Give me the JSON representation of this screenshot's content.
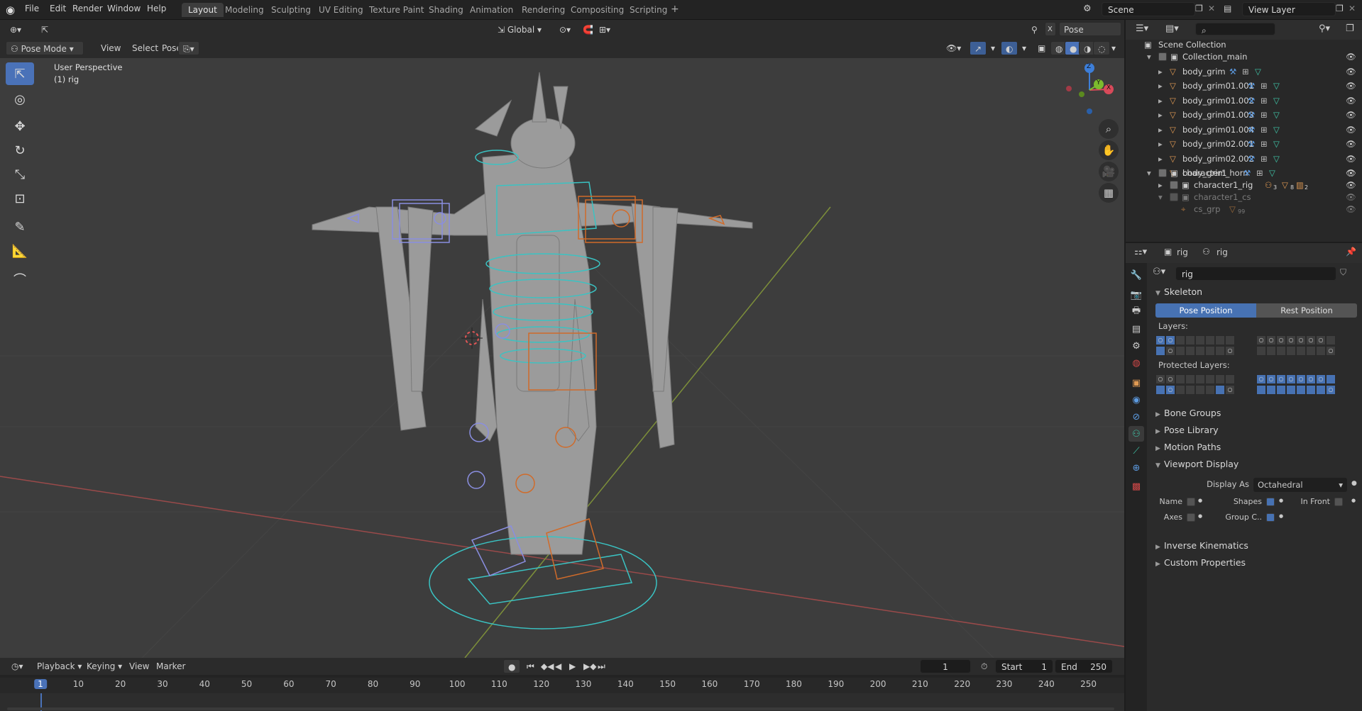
{
  "menu": {
    "items": [
      "File",
      "Edit",
      "Render",
      "Window",
      "Help"
    ]
  },
  "workspaces": [
    {
      "label": "Layout",
      "active": true
    },
    {
      "label": "Modeling"
    },
    {
      "label": "Sculpting"
    },
    {
      "label": "UV Editing"
    },
    {
      "label": "Texture Paint"
    },
    {
      "label": "Shading"
    },
    {
      "label": "Animation"
    },
    {
      "label": "Rendering"
    },
    {
      "label": "Compositing"
    },
    {
      "label": "Scripting"
    }
  ],
  "topright": {
    "scene": "Scene",
    "view_layer": "View Layer"
  },
  "viewport": {
    "transform_orientation": "Global",
    "pose_options": "Pose Options",
    "mode": "Pose Mode",
    "menus": [
      "View",
      "Select",
      "Pose"
    ],
    "overlay_line1": "User Perspective",
    "overlay_line2": "(1) rig",
    "gizmo": {
      "z": "Z",
      "y": "Y",
      "x": "X"
    }
  },
  "outliner": {
    "root": "Scene Collection",
    "rows": [
      {
        "label": "Collection_main"
      },
      {
        "label": "body_grim"
      },
      {
        "label": "body_grim01.001"
      },
      {
        "label": "body_grim01.002"
      },
      {
        "label": "body_grim01.003"
      },
      {
        "label": "body_grim01.004"
      },
      {
        "label": "body_grim02.001"
      },
      {
        "label": "body_grim02.002"
      },
      {
        "label": "body_grim_horn"
      },
      {
        "label": "character1"
      },
      {
        "label": "character1_rig"
      },
      {
        "label": "character1_cs"
      },
      {
        "label": "cs_grp"
      }
    ],
    "badges": {
      "rig_bones": "3",
      "rig_mesh": "8",
      "rig_mat": "2",
      "cs_count": "99"
    }
  },
  "properties": {
    "context_object": "rig",
    "context_data": "rig",
    "data_name": "rig",
    "skeleton_label": "Skeleton",
    "pose_position": "Pose Position",
    "rest_position": "Rest Position",
    "layers_label": "Layers:",
    "protected_label": "Protected Layers:",
    "sections": [
      "Bone Groups",
      "Pose Library",
      "Motion Paths",
      "Viewport Display",
      "Inverse Kinematics",
      "Custom Properties"
    ],
    "display_as_label": "Display As",
    "display_as_value": "Octahedral",
    "name_label": "Name",
    "shapes_label": "Shapes",
    "in_front_label": "In Front",
    "axes_label": "Axes",
    "group_colors_label": "Group C.."
  },
  "timeline": {
    "menus": [
      "Playback",
      "Keying",
      "View",
      "Marker"
    ],
    "current_frame": "1",
    "start_label": "Start",
    "start_value": "1",
    "end_label": "End",
    "end_value": "250",
    "ruler": [
      "1",
      "10",
      "20",
      "30",
      "40",
      "50",
      "60",
      "70",
      "80",
      "90",
      "100",
      "110",
      "120",
      "130",
      "140",
      "150",
      "160",
      "170",
      "180",
      "190",
      "200",
      "210",
      "220",
      "230",
      "240",
      "250"
    ]
  }
}
